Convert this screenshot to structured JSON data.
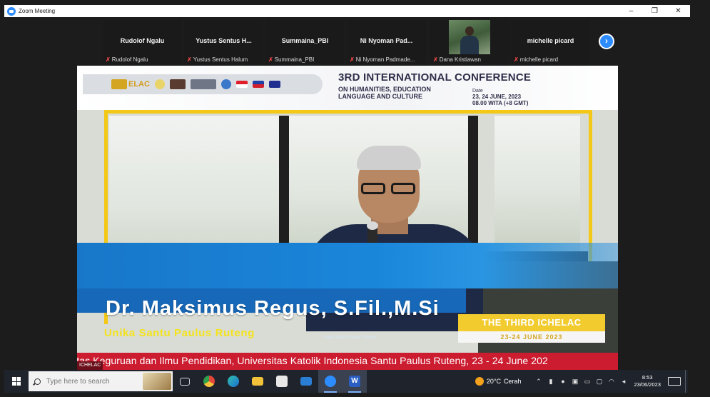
{
  "window": {
    "title": "Zoom Meeting",
    "controls": [
      "‒",
      "❐",
      "✕"
    ]
  },
  "participants": [
    {
      "name": "Rudolof Ngalu",
      "label": "Rudolof Ngalu",
      "muted": true
    },
    {
      "name": "Yustus Sentus H...",
      "label": "Yustus Sentus Halum",
      "muted": true
    },
    {
      "name": "Summaina_PBI",
      "label": "Summaina_PBI",
      "muted": true
    },
    {
      "name": "Ni Nyoman Pad...",
      "label": "Ni Nyoman Padmade...",
      "muted": true
    },
    {
      "name": "",
      "label": "Dana Kristiawan",
      "muted": true,
      "video": true
    },
    {
      "name": "michelle picard",
      "label": "michelle picard",
      "muted": true
    }
  ],
  "strip": {
    "next_icon": "chevron-right-icon",
    "next_glyph": "›"
  },
  "slide": {
    "logo_text": "ELAC",
    "conference_title": "3RD INTERNATIONAL CONFERENCE",
    "conference_subtitle": "ON HUMANITIES, EDUCATION LANGUAGE AND CULTURE",
    "date_label": "Date",
    "date_value": "23, 24 JUNE, 2023",
    "time_value": "08.00 WITA (+8 GMT)"
  },
  "lower_third": {
    "speaker_name": "Dr. Maksimus Regus, S.Fil.,M.Si",
    "speaker_affiliation": "Unika Santu Paulus Ruteng",
    "affiliation_small": "Unika Santu Paulus Ruteng",
    "event_badge": "THE THIRD ICHELAC",
    "event_dates": "23-24 JUNE 2023",
    "ticker": "ltas Keguruan dan Ilmu Pendidikan, Universitas Katolik Indonesia Santu Paulus Ruteng, 23 - 24 June 202",
    "tag": "ICHELAC"
  },
  "taskbar": {
    "search_placeholder": "Type here to search",
    "apps": [
      {
        "name": "task-view",
        "color": "#cfd6e2",
        "active": false
      },
      {
        "name": "chrome",
        "color": "#e4463b",
        "active": false
      },
      {
        "name": "edge",
        "color": "#1e90d6",
        "active": false
      },
      {
        "name": "file-explorer",
        "color": "#f2c33a",
        "active": false
      },
      {
        "name": "store",
        "color": "#4f8ad6",
        "active": false
      },
      {
        "name": "mail",
        "color": "#2a7fd4",
        "active": false
      },
      {
        "name": "zoom",
        "color": "#2d8cff",
        "active": true
      },
      {
        "name": "word",
        "color": "#2b5ec2",
        "active": true
      }
    ],
    "weather_temp": "20°C",
    "weather_text": "Cerah",
    "time": "8:53",
    "date": "23/06/2023"
  },
  "colors": {
    "accent_blue": "#1a7fd6",
    "ticker_red": "#cc1c30",
    "highlight_yellow": "#f4e31a",
    "frame_yellow": "#f3c816"
  }
}
